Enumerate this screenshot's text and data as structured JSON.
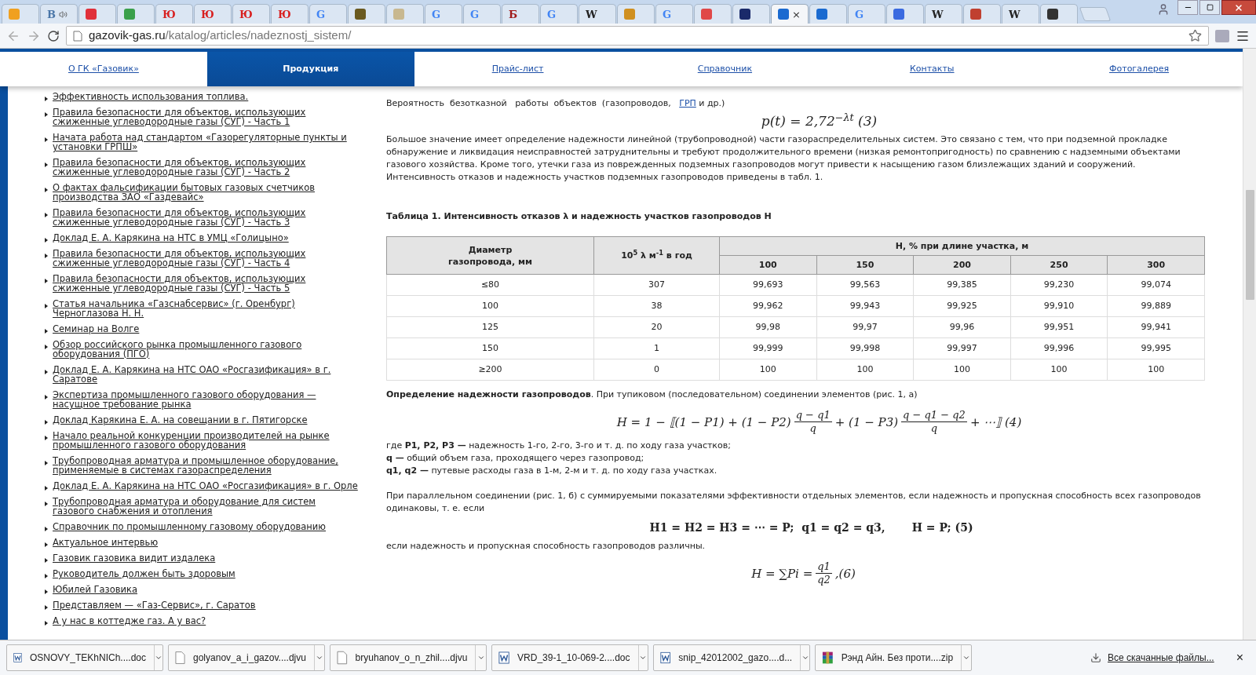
{
  "browser": {
    "tabs": [
      {
        "color": "#f0a020",
        "selected": false
      },
      {
        "glyph": "B",
        "color": "#4a76a8",
        "audio": true,
        "selected": false
      },
      {
        "color": "#e0303a",
        "selected": false
      },
      {
        "color": "#3aa04a",
        "selected": false
      },
      {
        "glyph": "Ю",
        "color": "#d82020",
        "selected": false
      },
      {
        "glyph": "Ю",
        "color": "#d82020",
        "selected": false
      },
      {
        "glyph": "Ю",
        "color": "#d82020",
        "selected": false
      },
      {
        "glyph": "Ю",
        "color": "#d82020",
        "selected": false
      },
      {
        "glyph": "G",
        "color": "#4285f4",
        "selected": false
      },
      {
        "color": "#6a5a20",
        "selected": false
      },
      {
        "color": "#c8b890",
        "selected": false
      },
      {
        "glyph": "G",
        "color": "#4285f4",
        "selected": false
      },
      {
        "glyph": "G",
        "color": "#4285f4",
        "selected": false
      },
      {
        "glyph": "Б",
        "color": "#a01818",
        "selected": false
      },
      {
        "glyph": "G",
        "color": "#4285f4",
        "selected": false
      },
      {
        "glyph": "W",
        "color": "#222222",
        "selected": false
      },
      {
        "color": "#d09020",
        "selected": false
      },
      {
        "glyph": "G",
        "color": "#4285f4",
        "selected": false
      },
      {
        "color": "#e04848",
        "selected": false
      },
      {
        "color": "#1a2a6a",
        "selected": false
      },
      {
        "color": "#1a6ad0",
        "selected": true,
        "close": "×"
      },
      {
        "color": "#1a6ad0",
        "selected": false
      },
      {
        "glyph": "G",
        "color": "#4285f4",
        "selected": false
      },
      {
        "color": "#3a6ae0",
        "selected": false
      },
      {
        "glyph": "W",
        "color": "#222222",
        "selected": false
      },
      {
        "color": "#c04030",
        "selected": false
      },
      {
        "glyph": "W",
        "color": "#222222",
        "selected": false
      },
      {
        "color": "#333333",
        "selected": false
      }
    ],
    "address": {
      "host": "gazovik-gas.ru",
      "path": "/katalog/articles/nadeznostj_sistem/"
    }
  },
  "nav": [
    {
      "label": "О ГК «Газовик»",
      "selected": false
    },
    {
      "label": "Продукция",
      "selected": true
    },
    {
      "label": "Прайс-лист",
      "selected": false
    },
    {
      "label": "Справочник",
      "selected": false
    },
    {
      "label": "Контакты",
      "selected": false
    },
    {
      "label": "Фотогалерея",
      "selected": false
    }
  ],
  "sidebar": [
    "Эффективность использования топлива.",
    "Правила безопасности для объектов, использующих сжиженные углеводородные газы (СУГ) - Часть 1",
    "Начата работа над стандартом «Газорегуляторные пункты и установки ГРПШ»",
    "Правила безопасности для объектов, использующих сжиженные углеводородные газы (СУГ) - Часть 2",
    "О фактах фальсификации бытовых газовых счетчиков производства ЗАО «Газдевайс»",
    "Правила безопасности для объектов, использующих сжиженные углеводородные газы (СУГ) - Часть 3",
    "Доклад Е. А. Карякина на НТС в УМЦ «Голицыно»",
    "Правила безопасности для объектов, использующих сжиженные углеводородные газы (СУГ) - Часть 4",
    "Правила безопасности для объектов, использующих сжиженные углеводородные газы (СУГ) - Часть 5",
    "Статья начальника «Газснабсервис» (г. Оренбург) Черноглазова Н. Н.",
    "Семинар на Волге",
    "Обзор российского рынка промышленного газового оборудования (ПГО)",
    "Доклад Е. А. Карякина на НТС ОАО «Росгазификация» в г. Саратове",
    "Экспертиза промышленного газового оборудования — насущное требование рынка",
    "Доклад Карякина Е. А. на совещании в г. Пятигорске",
    "Начало реальной конкуренции производителей на рынке промышленного газового оборудования",
    "Трубопроводная арматура и промышленное оборудование, применяемые в системах газораспределения",
    "Доклад Е. А. Карякина на НТС ОАО «Росгазификация» в г. Орле",
    "Трубопроводная арматура и оборудование для систем газового снабжения и отопления",
    "Справочник по промышленному газовому оборудованию",
    "Актуальное интервью",
    "Газовик газовика видит издалека",
    "Руководитель должен быть здоровым",
    "Юбилей Газовика",
    "Представляем — «Газ-Сервис», г. Саратов",
    "А у нас в коттедже газ. А у вас?"
  ],
  "article": {
    "intro": {
      "before": "Вероятность  безотказной   работы  объектов  (газопроводов,",
      "link": "ГРП",
      "after": "и др.)"
    },
    "formula_3": "p(t) = 2,72$^{−λt}$ (3)",
    "paragraph_1": "Большое значение имеет определение надежности линейной (трубопроводной) части газораспределительных систем. Это связано с тем, что при подземной прокладке обнаружение и ликвидация неисправностей затруднительны и требуют продолжительного времени (низкая ремонтопригодность) по сравнению с надземными объектами газового хозяйства. Кроме того, утечки газа из поврежденных подземных газопроводов могут привести к насыщению газом близлежащих зданий и сооружений. Интенсивность отказов и надежность участков  подземных  газопроводов  приведены  в табл.  1.",
    "table_title": "Таблица 1. Интенсивность отказов λ и  надежность участков газопроводов Н",
    "table": {
      "col_1": "Диаметр газопровода, мм",
      "col_2": "10$^{5}$ λ м$^{-1}$ в  год",
      "group": "Н,  % при длине участка, м",
      "lengths": [
        "100",
        "150",
        "200",
        "250",
        "300"
      ],
      "rows": [
        [
          "≤80",
          "307",
          "99,693",
          "99,563",
          "99,385",
          "99,230",
          "99,074"
        ],
        [
          "100",
          "38",
          "99,962",
          "99,943",
          "99,925",
          "99,910",
          "99,889"
        ],
        [
          "125",
          "20",
          "99,98",
          "99,97",
          "99,96",
          "99,951",
          "99,941"
        ],
        [
          "150",
          "1",
          "99,999",
          "99,998",
          "99,997",
          "99,996",
          "99,995"
        ],
        [
          "≥200",
          "0",
          "100",
          "100",
          "100",
          "100",
          "100"
        ]
      ]
    },
    "paragraph_2": "**Определение  надежности  газопроводов**. При  тупиковом (последовательном) соединении  элементов  (рис. 1, а)",
    "formula_4": [
      {
        "kind": "text",
        "text": "H = 1 − ⟦(1 − P1) + (1 − P2)"
      },
      {
        "kind": "frac",
        "num": "q − q1",
        "den": "q"
      },
      {
        "kind": "text",
        "text": "+ (1 − P3)"
      },
      {
        "kind": "frac",
        "num": "q − q1 − q2",
        "den": "q"
      },
      {
        "kind": "text",
        "text": "+ ⋯⟧ (4)"
      }
    ],
    "legend": [
      "где **P1, P2, P3 —** надежность 1-го, 2-го, 3-го и т. д. по ходу газа участков;",
      "**q —** общий объем газа, проходящего через газопровод;",
      "**q1, q2 —** путевые  расходы   газа  в   1-м,   2-м  и  т.   д.   по  ходу  газа участках."
    ],
    "paragraph_3": "При параллельном соединении (рис. 1, б) с суммируемыми показателями эффективности отдельных элементов, если надежность и пропускная способность всех газопроводов одинаковы, т. е. если",
    "formula_5": "H1 = H2 = H3 = ⋯ = P;  q1 = q2 = q3,       H = P; (5)",
    "paragraph_4": "если надежность и пропускная способность газопроводов различны.",
    "formula_6": [
      {
        "kind": "text",
        "text": "H = ∑Pi ="
      },
      {
        "kind": "frac",
        "num": "q1",
        "den": "q2"
      },
      {
        "kind": "text",
        "text": ",(6)"
      }
    ]
  },
  "downloads": {
    "items": [
      {
        "name": "OSNOVY_TEKhNICh....doc",
        "kind": "doc"
      },
      {
        "name": "golyanov_a_i_gazov....djvu",
        "kind": "djvu"
      },
      {
        "name": "bryuhanov_o_n_zhil....djvu",
        "kind": "djvu"
      },
      {
        "name": "VRD_39-1_10-069-2....doc",
        "kind": "doc"
      },
      {
        "name": "snip_42012002_gazo....d...",
        "kind": "doc"
      },
      {
        "name": "Рэнд Айн. Без проти....zip",
        "kind": "zip"
      }
    ],
    "all_link": "Все скачанные файлы...",
    "close": "×"
  }
}
